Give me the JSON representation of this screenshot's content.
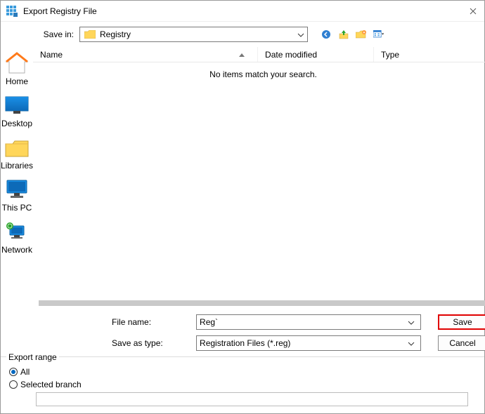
{
  "title": "Export Registry File",
  "savein": {
    "label": "Save in:",
    "value": "Registry"
  },
  "columns": {
    "name": "Name",
    "date": "Date modified",
    "type": "Type"
  },
  "empty_message": "No items match your search.",
  "places": {
    "home": "Home",
    "desktop": "Desktop",
    "libraries": "Libraries",
    "thispc": "This PC",
    "network": "Network"
  },
  "fields": {
    "filename_label": "File name:",
    "filename_value": "Reg`",
    "saveas_label": "Save as type:",
    "saveas_value": "Registration Files (*.reg)"
  },
  "buttons": {
    "save": "Save",
    "cancel": "Cancel"
  },
  "export_range": {
    "legend": "Export range",
    "all": "All",
    "selected": "Selected branch",
    "branch_value": ""
  }
}
